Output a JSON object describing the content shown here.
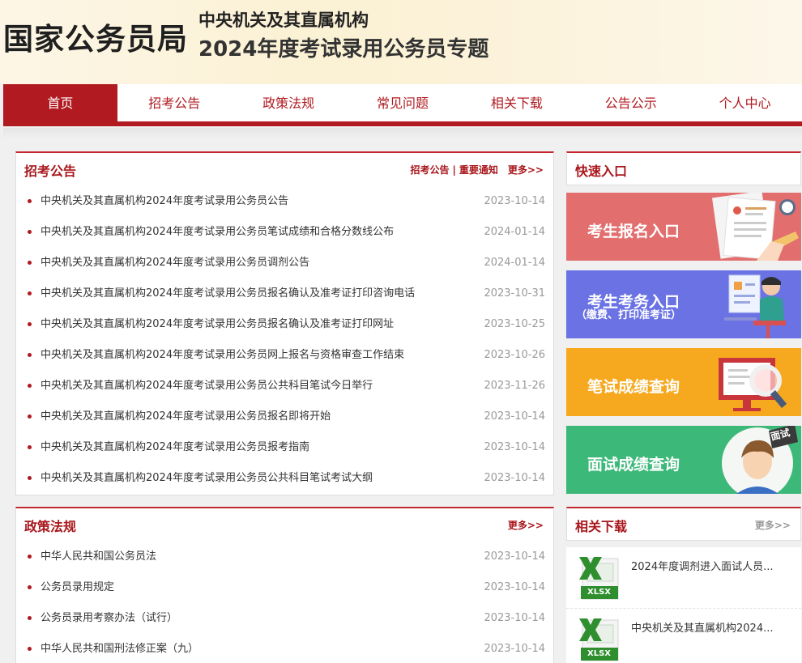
{
  "header": {
    "logo": "国家公务员局",
    "subtitle1": "中央机关及其直属机构",
    "subtitle2": "2024年度考试录用公务员专题"
  },
  "nav": [
    "首页",
    "招考公告",
    "政策法规",
    "常见问题",
    "相关下载",
    "公告公示",
    "个人中心"
  ],
  "recruit": {
    "title": "招考公告",
    "link1": "招考公告",
    "sep": "|",
    "link2": "重要通知",
    "more": "更多>>",
    "items": [
      {
        "title": "中央机关及其直属机构2024年度考试录用公务员公告",
        "date": "2023-10-14"
      },
      {
        "title": "中央机关及其直属机构2024年度考试录用公务员笔试成绩和合格分数线公布",
        "date": "2024-01-14"
      },
      {
        "title": "中央机关及其直属机构2024年度考试录用公务员调剂公告",
        "date": "2024-01-14"
      },
      {
        "title": "中央机关及其直属机构2024年度考试录用公务员报名确认及准考证打印咨询电话",
        "date": "2023-10-31"
      },
      {
        "title": "中央机关及其直属机构2024年度考试录用公务员报名确认及准考证打印网址",
        "date": "2023-10-25"
      },
      {
        "title": "中央机关及其直属机构2024年度考试录用公务员网上报名与资格审查工作结束",
        "date": "2023-10-26"
      },
      {
        "title": "中央机关及其直属机构2024年度考试录用公务员公共科目笔试今日举行",
        "date": "2023-11-26"
      },
      {
        "title": "中央机关及其直属机构2024年度考试录用公务员报名即将开始",
        "date": "2023-10-14"
      },
      {
        "title": "中央机关及其直属机构2024年度考试录用公务员报考指南",
        "date": "2023-10-14"
      },
      {
        "title": "中央机关及其直属机构2024年度考试录用公务员公共科目笔试考试大纲",
        "date": "2023-10-14"
      }
    ]
  },
  "policy": {
    "title": "政策法规",
    "more": "更多>>",
    "items": [
      {
        "title": "中华人民共和国公务员法",
        "date": "2023-10-14"
      },
      {
        "title": "公务员录用规定",
        "date": "2023-10-14"
      },
      {
        "title": "公务员录用考察办法（试行）",
        "date": "2023-10-14"
      },
      {
        "title": "中华人民共和国刑法修正案（九）",
        "date": "2023-10-14"
      }
    ]
  },
  "quick": {
    "title": "快速入口",
    "register": "考生报名入口",
    "affairs": "考生考务入口",
    "affairs_sub": "（缴费、打印准考证）",
    "written": "笔试成绩查询",
    "interview": "面试成绩查询",
    "interview_badge": "面试",
    "colors": {
      "register": "#e57373",
      "affairs": "#6a7de8",
      "written": "#f5a623",
      "interview": "#43b97a"
    }
  },
  "downloads": {
    "title": "相关下载",
    "more": "更多>>",
    "icon_label": "XLSX",
    "items": [
      "2024年度调剂进入面试人员...",
      "中央机关及其直属机构2024..."
    ]
  }
}
